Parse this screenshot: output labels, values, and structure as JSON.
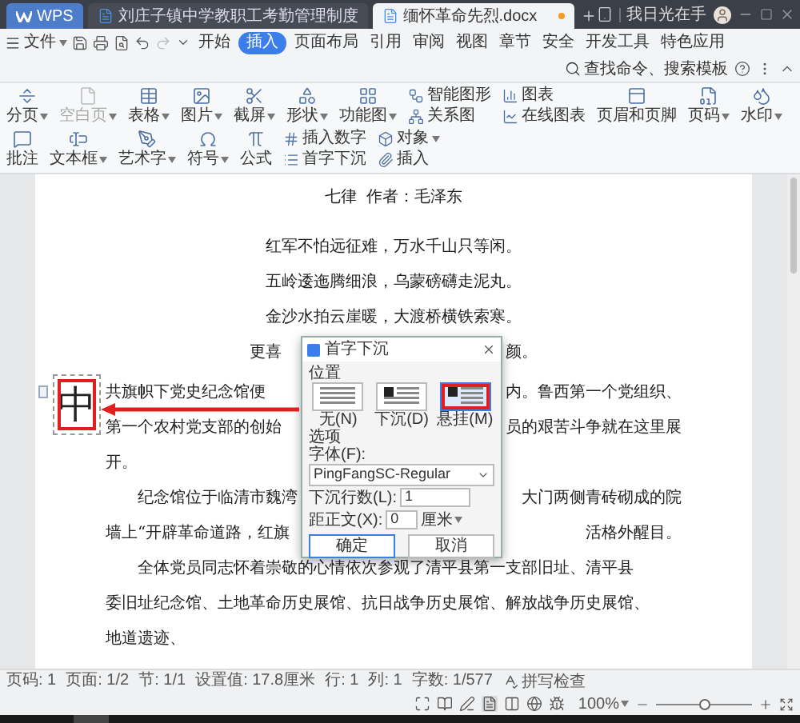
{
  "title_bar": {
    "app": "WPS",
    "tabs": [
      {
        "title": "刘庄子镇中学教职工考勤管理制度",
        "selected": false,
        "modified": false
      },
      {
        "title": "缅怀革命先烈.docx",
        "selected": true,
        "modified": true
      }
    ],
    "user": "我日光在手"
  },
  "menu": {
    "file": "文件",
    "tabs": [
      {
        "label": "开始",
        "selected": false
      },
      {
        "label": "插入",
        "selected": true
      },
      {
        "label": "页面布局",
        "selected": false
      },
      {
        "label": "引用",
        "selected": false
      },
      {
        "label": "审阅",
        "selected": false
      },
      {
        "label": "视图",
        "selected": false
      },
      {
        "label": "章节",
        "selected": false
      },
      {
        "label": "安全",
        "selected": false
      },
      {
        "label": "开发工具",
        "selected": false
      },
      {
        "label": "特色应用",
        "selected": false
      }
    ],
    "search": "查找命令、搜索模板"
  },
  "ribbon": {
    "items": [
      {
        "label": "分页",
        "kind": "big",
        "dropdown": true,
        "disabled": false
      },
      {
        "label": "空白页",
        "kind": "big",
        "dropdown": true,
        "disabled": true
      },
      {
        "label": "表格",
        "kind": "big",
        "dropdown": true,
        "disabled": false
      },
      {
        "label": "图片",
        "kind": "big",
        "dropdown": true,
        "disabled": false
      },
      {
        "label": "截屏",
        "kind": "big",
        "dropdown": true,
        "disabled": false
      },
      {
        "label": "形状",
        "kind": "big",
        "dropdown": true,
        "disabled": false
      },
      {
        "label": "功能图",
        "kind": "big",
        "dropdown": true,
        "disabled": false
      },
      {
        "label": "智能图形",
        "kind": "small",
        "dropdown": false,
        "disabled": false
      },
      {
        "label": "关系图",
        "kind": "small",
        "dropdown": false,
        "disabled": false
      },
      {
        "label": "图表",
        "kind": "small",
        "dropdown": false,
        "disabled": false
      },
      {
        "label": "在线图表",
        "kind": "small",
        "dropdown": false,
        "disabled": false
      },
      {
        "label": "页眉和页脚",
        "kind": "big",
        "dropdown": false,
        "disabled": false
      },
      {
        "label": "页码",
        "kind": "big",
        "dropdown": true,
        "disabled": false
      },
      {
        "label": "水印",
        "kind": "big",
        "dropdown": true,
        "disabled": false
      },
      {
        "label": "批注",
        "kind": "big",
        "dropdown": false,
        "disabled": false
      },
      {
        "label": "文本框",
        "kind": "big",
        "dropdown": true,
        "disabled": false
      },
      {
        "label": "艺术字",
        "kind": "big",
        "dropdown": true,
        "disabled": false
      },
      {
        "label": "符号",
        "kind": "big",
        "dropdown": true,
        "disabled": false
      },
      {
        "label": "公式",
        "kind": "big",
        "dropdown": false,
        "disabled": false
      },
      {
        "label": "插入数字",
        "kind": "small",
        "dropdown": false,
        "disabled": false
      },
      {
        "label": "首字下沉",
        "kind": "small",
        "dropdown": false,
        "disabled": false
      },
      {
        "label": "对象",
        "kind": "small",
        "dropdown": true,
        "disabled": false
      },
      {
        "label": "插入",
        "kind": "small",
        "dropdown": false,
        "disabled": false
      }
    ]
  },
  "document": {
    "title": "七律  作者：毛泽东",
    "poem": [
      [
        "红军不怕远征难，万水千山只等闲。"
      ],
      [
        "五岭逶迤腾细浪，乌蒙磅礴走泥丸。"
      ],
      [
        "金沙水拍云崖暖，大渡桥横铁索寒。"
      ],
      [
        "更喜",
        "颜。"
      ]
    ],
    "drop_cap": {
      "text": "中",
      "annotated": true
    },
    "paragraphs": [
      {
        "kind": "drop_cap",
        "lines": [
          [
            "共旗帜下党史纪念馆便",
            "内。鲁西第一个党组织、"
          ],
          [
            "第一个农村党支部的创始",
            "员的艰苦斗争就在这里展"
          ],
          [
            "开。"
          ]
        ]
      },
      {
        "kind": "indented",
        "lines": [
          [
            "纪念馆位于临清市魏湾",
            "大门两侧青砖砌成的院"
          ],
          [
            "墙上“开辟革命道路，红旗",
            "活格外醒目。"
          ]
        ]
      },
      {
        "kind": "indented",
        "lines": [
          [
            "全体党员同志怀着崇敬的心情依次参观了清平县第一支部旧址、清平县"
          ],
          [
            "委旧址纪念馆、土地革命历史展馆、抗日战争历史展馆、解放战争历史展馆、"
          ],
          [
            "地道遗迹、"
          ]
        ]
      }
    ]
  },
  "dialog": {
    "title": "首字下沉",
    "position_label": "位置",
    "options": [
      {
        "label": "无(N)",
        "selected": false,
        "annotated": false
      },
      {
        "label": "下沉(D)",
        "selected": false,
        "annotated": false
      },
      {
        "label": "悬挂(M)",
        "selected": true,
        "annotated": true
      }
    ],
    "options_label": "选项",
    "font_label": "字体(F):",
    "font_value": "PingFangSC-Regular",
    "lines_label": "下沉行数(L):",
    "lines_value": "1",
    "distance_label": "距正文(X):",
    "distance_value": "0",
    "distance_unit": "厘米",
    "ok": "确定",
    "cancel": "取消"
  },
  "status_bar": {
    "items": [
      "页码: 1",
      "页面: 1/2",
      "节: 1/1",
      "设置值: 17.8厘米",
      "行: 1",
      "列: 1",
      "字数: 1/577"
    ],
    "spell_check": "拼写检查",
    "zoom": {
      "reading": "100%",
      "level": 0.5
    }
  }
}
